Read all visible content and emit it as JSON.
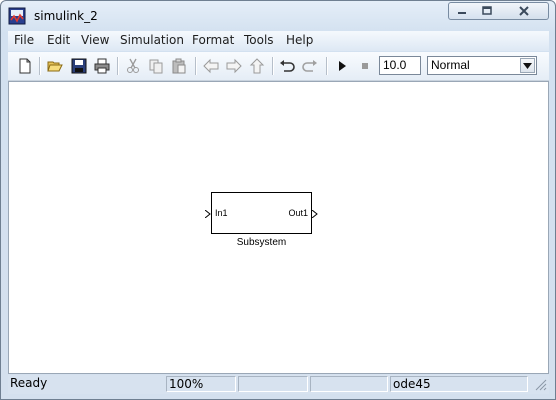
{
  "window": {
    "title": "simulink_2"
  },
  "menubar": {
    "items": [
      "File",
      "Edit",
      "View",
      "Simulation",
      "Format",
      "Tools",
      "Help"
    ]
  },
  "toolbar": {
    "icons": [
      "new-icon",
      "open-icon",
      "save-icon",
      "print-icon",
      "cut-icon",
      "copy-icon",
      "paste-icon",
      "back-icon",
      "forward-icon",
      "up-icon",
      "undo-icon",
      "redo-icon",
      "start-simulation-icon",
      "stop-simulation-icon"
    ],
    "stop_time": "10.0",
    "simulation_mode": "Normal"
  },
  "model": {
    "block": {
      "name": "Subsystem",
      "input_port": "In1",
      "output_port": "Out1"
    }
  },
  "statusbar": {
    "status": "Ready",
    "zoom": "100%",
    "cell3": "",
    "cell4": "",
    "solver": "ode45"
  }
}
